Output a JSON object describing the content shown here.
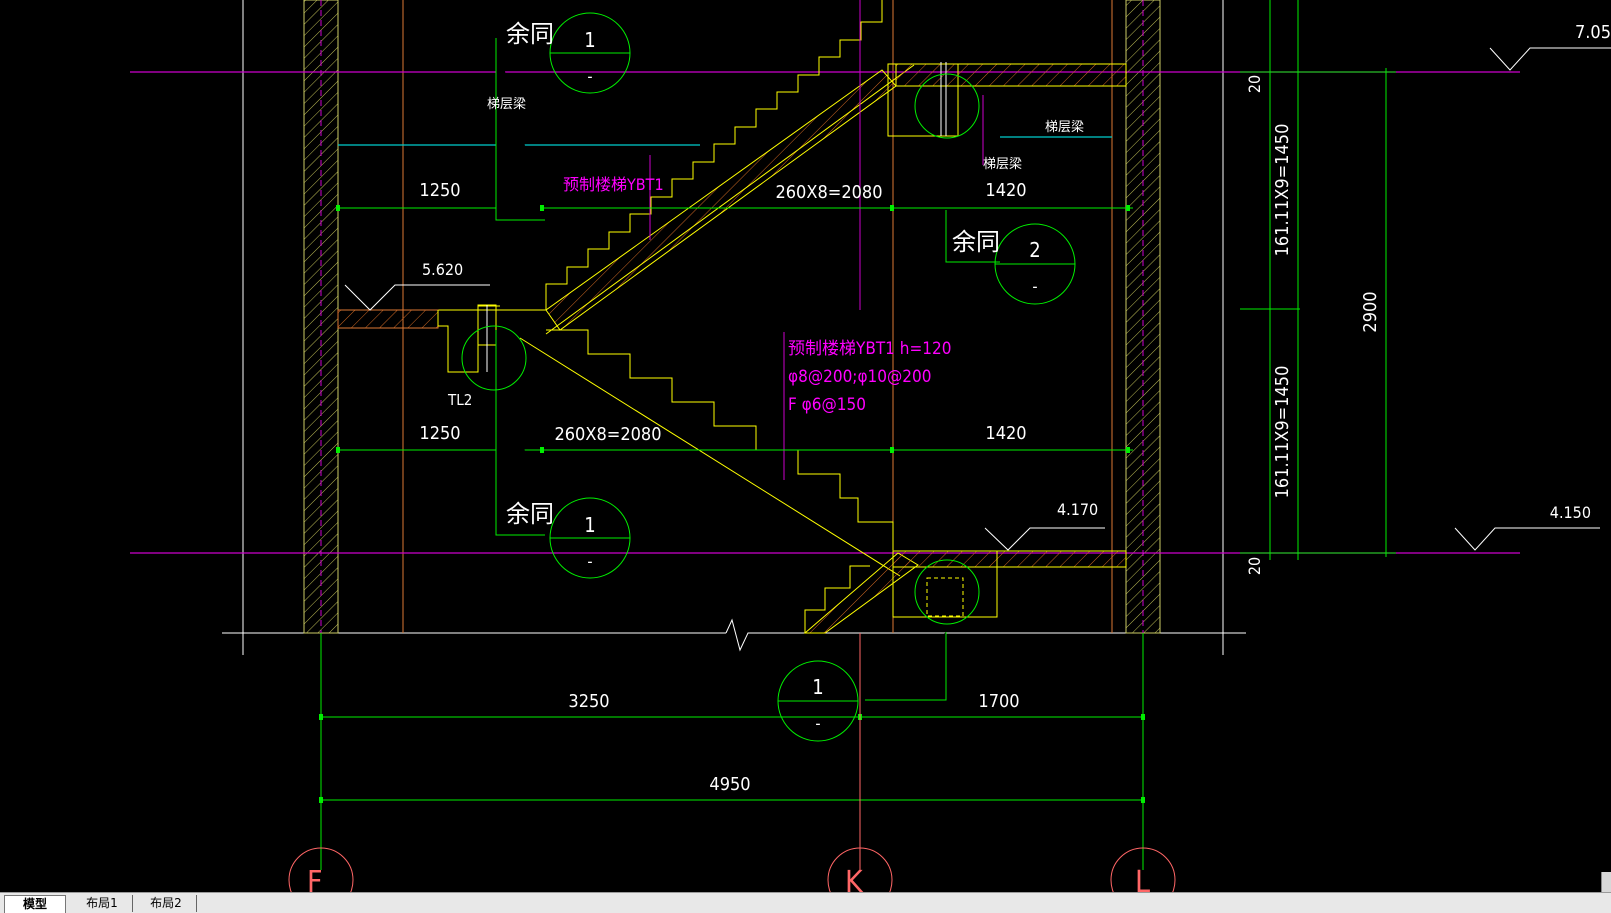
{
  "drawing": {
    "colors": {
      "background": "#000000",
      "dimension": "#00ff00",
      "stair": "#ffff00",
      "elevation_line": "#cc00cc",
      "grid_axis": "#ff6666",
      "wall_hatch": "#cccc66",
      "annotation_magenta": "#ff00ff",
      "beam_cyan": "#00ffff",
      "text_white": "#ffffff"
    },
    "labels": {
      "elev_top_right": "7.05",
      "elev_mid": "5.620",
      "elev_lower": "4.170",
      "elev_bottom_right": "4.150",
      "beam_left": "梯层梁",
      "beam_right": "梯层梁",
      "beam_right_2": "梯层梁",
      "ybt1_upper": "预制楼梯YBT1",
      "ybt1_detail_line1": "预制楼梯YBT1  h=120",
      "ybt1_detail_line2": "φ8@200;φ10@200",
      "ybt1_detail_line3": "F φ6@150",
      "tl2": "TL2",
      "note_same": "余同"
    },
    "dimensions": {
      "upper_left": "1250",
      "upper_mid": "260X8=2080",
      "upper_right": "1420",
      "lower_left": "1250",
      "lower_mid": "260X8=2080",
      "lower_right": "1420",
      "bottom_left": "3250",
      "bottom_right": "1700",
      "bottom_total": "4950",
      "vert_upper": "161.11X9=1450",
      "vert_lower": "161.11X9=1450",
      "vert_total": "2900",
      "vert_small_top": "20",
      "vert_small_bottom": "20"
    },
    "detail_markers": [
      {
        "num": "1",
        "sub": "-"
      },
      {
        "num": "2",
        "sub": "-"
      },
      {
        "num": "1",
        "sub": "-"
      },
      {
        "num": "1",
        "sub": "-"
      }
    ],
    "grid_axes": [
      "F",
      "K",
      "L"
    ]
  },
  "tabs": [
    "模型",
    "布局1",
    "布局2"
  ]
}
